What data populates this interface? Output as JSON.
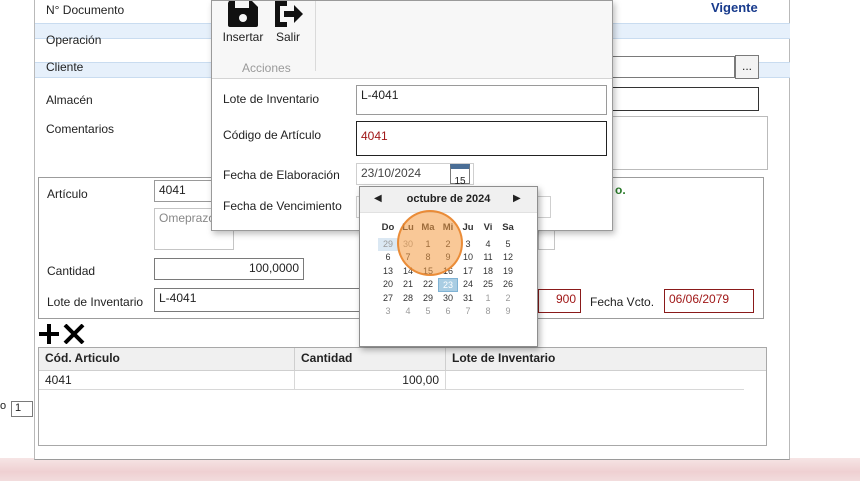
{
  "form": {
    "doc_label": "N° Documento",
    "status": "Vigente",
    "operation_label": "Operación",
    "client_label": "Cliente",
    "client_browse": "...",
    "warehouse_label": "Almacén",
    "comments_label": "Comentarios",
    "article_label": "Artículo",
    "article_code": "4041",
    "article_desc": "Omeprazo",
    "peek_suffix": "o.",
    "quantity_label": "Cantidad",
    "quantity_value": "100,0000",
    "lot_label": "Lote de Inventario",
    "lot_value": "L-4041",
    "elab_peek": "900",
    "expiry_label": "Fecha Vcto.",
    "expiry_value": "06/06/2079"
  },
  "left_edge": {
    "pager_value": "1"
  },
  "grid": {
    "headers": [
      "Cód. Articulo",
      "Cantidad",
      "Lote de Inventario"
    ],
    "rows": [
      {
        "code": "4041",
        "qty": "100,00",
        "lot": ""
      }
    ]
  },
  "popup": {
    "insert_label": "Insertar",
    "exit_label": "Salir",
    "group_label": "Acciones",
    "lot_label": "Lote de Inventario",
    "lot_value": "L-4041",
    "code_label": "Código de Artículo",
    "code_value": "4041",
    "elab_label": "Fecha de Elaboración",
    "elab_value": "23/10/2024",
    "calendar_icon_day": "15",
    "expiry_label": "Fecha de Vencimiento"
  },
  "calendar": {
    "month_title": "octubre de 2024",
    "prev_glyph": "◀",
    "next_glyph": "▶",
    "weekdays": [
      "Do",
      "Lu",
      "Ma",
      "Mi",
      "Ju",
      "Vi",
      "Sa"
    ],
    "selected_day": "23",
    "weeks": [
      [
        "29",
        "30",
        "1",
        "2",
        "3",
        "4",
        "5"
      ],
      [
        "6",
        "7",
        "8",
        "9",
        "10",
        "11",
        "12"
      ],
      [
        "13",
        "14",
        "15",
        "16",
        "17",
        "18",
        "19"
      ],
      [
        "20",
        "21",
        "22",
        "23",
        "24",
        "25",
        "26"
      ],
      [
        "27",
        "28",
        "29",
        "30",
        "31",
        "1",
        "2"
      ],
      [
        "3",
        "4",
        "5",
        "6",
        "7",
        "8",
        "9"
      ]
    ]
  },
  "colors": {
    "accent_blue": "#173a8c",
    "value_red": "#a01818",
    "calendar_selected": "#a9cde3",
    "click_marker": "#f49b41"
  }
}
